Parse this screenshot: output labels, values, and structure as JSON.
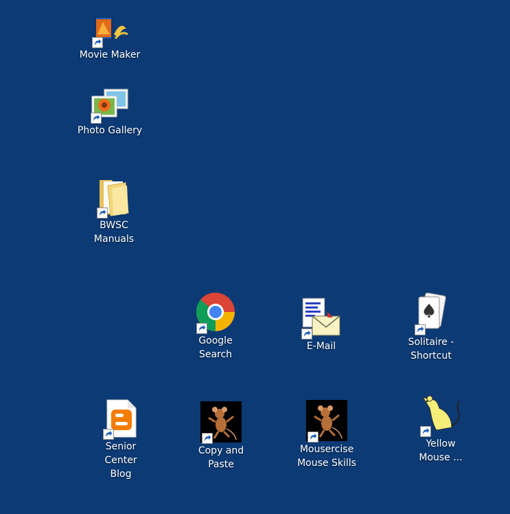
{
  "desktop": {
    "background_color": "#0c3a74",
    "icons": [
      {
        "label": "Movie Maker",
        "icon": "movie-maker-icon",
        "shortcut": true
      },
      {
        "label": "Photo Gallery",
        "icon": "photo-gallery-icon",
        "shortcut": true
      },
      {
        "label": "BWSC\nManuals",
        "icon": "folder-icon",
        "shortcut": true
      },
      {
        "label": "Google\nSearch",
        "icon": "chrome-icon",
        "shortcut": true
      },
      {
        "label": "E-Mail",
        "icon": "email-icon",
        "shortcut": true
      },
      {
        "label": "Solitaire -\nShortcut",
        "icon": "solitaire-icon",
        "shortcut": true
      },
      {
        "label": "Senior Center\nBlog",
        "icon": "blogger-icon",
        "shortcut": true
      },
      {
        "label": "Copy and\nPaste",
        "icon": "mouse-cartoon-icon",
        "shortcut": true
      },
      {
        "label": "Mousercise\nMouse Skills",
        "icon": "mouse-cartoon-icon",
        "shortcut": true
      },
      {
        "label": "Yellow\nMouse ...",
        "icon": "yellow-mouse-icon",
        "shortcut": true
      }
    ]
  }
}
